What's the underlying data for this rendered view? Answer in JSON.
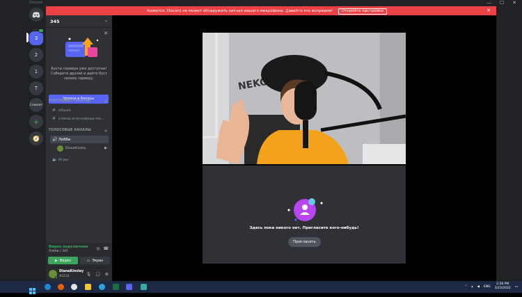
{
  "window": {
    "app_name": "Discord",
    "controls": [
      "—",
      "☐",
      "✕"
    ]
  },
  "banner": {
    "message": "Кажется, Discord не может обнаружить сигнал вашего микрофона. Давайте это исправим!",
    "button": "Откройте настройки",
    "close": "✕",
    "color": "#ed4245"
  },
  "servers": {
    "items": [
      {
        "label": "3",
        "active": true,
        "badge": true
      },
      {
        "label": "2"
      },
      {
        "label": "1"
      },
      {
        "label": "T"
      },
      {
        "label": "Саммит"
      },
      {
        "label": "+",
        "kind": "add-server"
      },
      {
        "label": "🧭",
        "kind": "explore"
      }
    ]
  },
  "sidebar": {
    "server_name": "345",
    "boost": {
      "text": "Бусты сервера уже доступны! Соберите друзей и дайте буст своему серверу.",
      "button": "Уровни и бонусы"
    },
    "text_category": "ТЕКСТОВЫЕ КАНАЛЫ",
    "text_channels": [
      "общее",
      "клипы-и-основные-мо..."
    ],
    "voice_category": "ГОЛОСОВЫЕ КАНАЛЫ",
    "voice_channels": [
      "Лобби",
      "Игры"
    ],
    "voice_member": "DianaKinsley"
  },
  "voice_panel": {
    "status": "Видео подключено",
    "subtitle": "Лобби / 345",
    "video_button": "Видео",
    "screen_button": "Экран"
  },
  "user_panel": {
    "name": "DianaKinsley",
    "tag": "#2153"
  },
  "stage": {
    "empty_text": "Здесь пока никого нет. Пригласите кого-нибудь!",
    "invite_button": "Пригласить"
  },
  "taskbar": {
    "language": "ENG",
    "time": "2:28 PM",
    "date": "3/23/2022"
  },
  "colors": {
    "accent": "#5865f2",
    "green": "#3ba55d",
    "sidebar": "#2f3136",
    "rail": "#202225"
  }
}
